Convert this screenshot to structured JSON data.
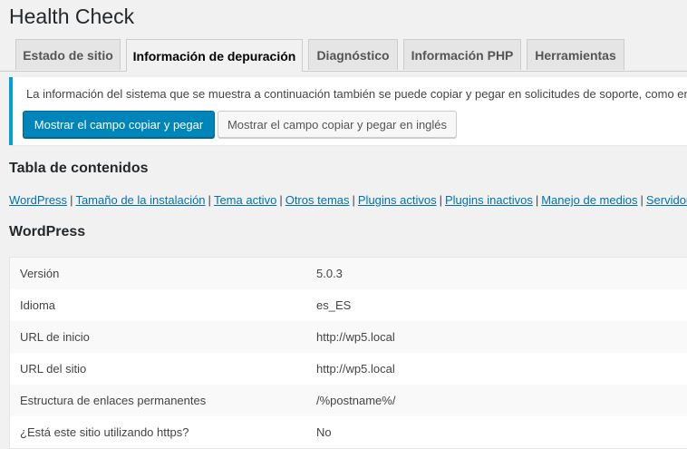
{
  "page": {
    "title": "Health Check"
  },
  "tabs": [
    {
      "label": "Estado de sitio",
      "active": false
    },
    {
      "label": "Información de depuración",
      "active": true
    },
    {
      "label": "Diagnóstico",
      "active": false
    },
    {
      "label": "Información PHP",
      "active": false
    },
    {
      "label": "Herramientas",
      "active": false
    }
  ],
  "notice": {
    "text": "La información del sistema que se muestra a continuación también se puede copiar y pegar en solicitudes de soporte, como en",
    "copy_button": "Mostrar el campo copiar y pegar",
    "copy_english_button": "Mostrar el campo copiar y pegar en inglés",
    "accent_color": "#00a0d2"
  },
  "toc": {
    "heading": "Tabla de contenidos",
    "separator": "|",
    "links": [
      "WordPress",
      "Tamaño de la instalación",
      "Tema activo",
      "Otros temas",
      "Plugins activos",
      "Plugins inactivos",
      "Manejo de medios",
      "Servidor"
    ]
  },
  "wordpress": {
    "heading": "WordPress",
    "rows": [
      {
        "label": "Versión",
        "value": "5.0.3"
      },
      {
        "label": "Idioma",
        "value": "es_ES"
      },
      {
        "label": "URL de inicio",
        "value": "http://wp5.local"
      },
      {
        "label": "URL del sitio",
        "value": "http://wp5.local"
      },
      {
        "label": "Estructura de enlaces permanentes",
        "value": "/%postname%/"
      },
      {
        "label": "¿Está este sitio utilizando https?",
        "value": "No"
      }
    ]
  },
  "colors": {
    "primary_button": "#0085ba",
    "link": "#0073aa",
    "background": "#f1f1f1"
  }
}
